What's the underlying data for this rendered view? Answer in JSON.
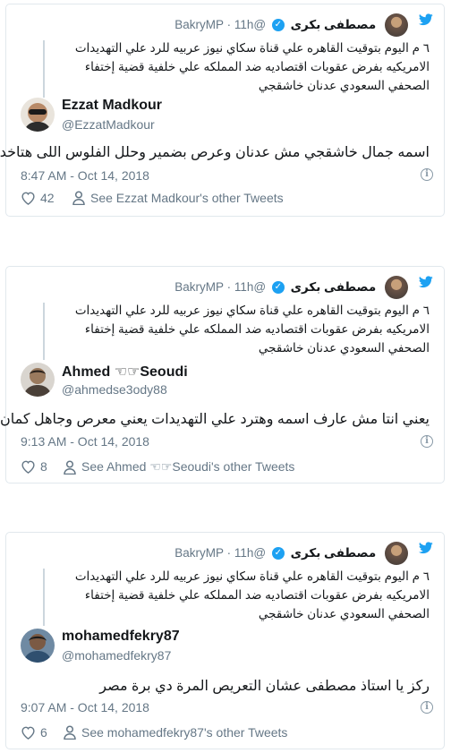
{
  "quoted_tweet": {
    "display_name": "مصطفى بكرى",
    "handle": "@BakryMP",
    "time": "11h",
    "text": "٦ م اليوم بتوقيت القاهره علي قناة سكاي نيوز عربيه للرد علي التهديدات الامريكيه بفرض عقوبات اقتصاديه ضد المملكه علي خلفية قضية إختفاء الصحفي السعودي عدنان خاشقجي"
  },
  "cards": [
    {
      "author_name": "Ezzat Madkour",
      "author_handle": "@EzzatMadkour",
      "text": "اسمه جمال خاشقجي  مش عدنان وعرص بضمير وحلل الفلوس اللى هتاخدها",
      "timestamp": "8:47 AM - Oct 14, 2018",
      "likes": "42",
      "other_tweets": "See Ezzat Madkour's other Tweets"
    },
    {
      "author_name": "Ahmed ☜☞Seoudi",
      "author_handle": "@ahmedse3ody88",
      "text": "يعني انتا مش عارف اسمه وهترد علي التهديدات  يعني معرص وجاهل كمان",
      "timestamp": "9:13 AM - Oct 14, 2018",
      "likes": "8",
      "other_tweets": "See Ahmed ☜☞Seoudi's other Tweets"
    },
    {
      "author_name": "mohamedfekry87",
      "author_handle": "@mohamedfekry87",
      "text": "ركز يا استاذ مصطفى عشان التعريص المرة دي برة مصر",
      "timestamp": "9:07 AM - Oct 14, 2018",
      "likes": "6",
      "other_tweets": "See mohamedfekry87's other Tweets"
    }
  ],
  "icons": {
    "brand": "twitter-bird-icon",
    "like": "heart-icon",
    "profile": "person-icon",
    "info": "info-icon"
  },
  "colors": {
    "brand_blue": "#1da1f2",
    "text_primary": "#14171a",
    "text_secondary": "#657786",
    "border": "#e1e8ed"
  }
}
